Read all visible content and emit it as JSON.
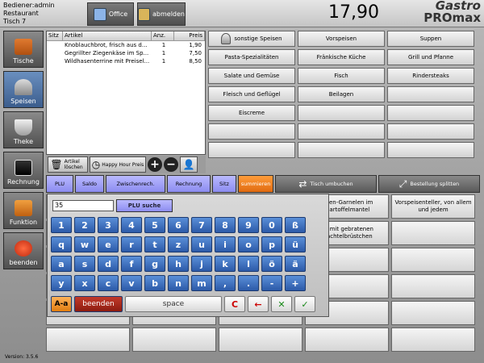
{
  "header": {
    "user_line1": "Bediener:admin",
    "user_line2": "Restaurant",
    "user_line3": "Tisch 7",
    "office_label": "Office",
    "abmelden_label": "abmelden",
    "total": "17,90",
    "logo_line1": "Gastro",
    "logo_line2": "PROmax"
  },
  "nav": [
    {
      "label": "Tische"
    },
    {
      "label": "Speisen"
    },
    {
      "label": "Theke"
    },
    {
      "label": "Rechnung"
    },
    {
      "label": "Funktion"
    },
    {
      "label": "beenden"
    }
  ],
  "version": "Version: 3.5.6",
  "order": {
    "columns": [
      "Sitz",
      "Artikel",
      "Anz.",
      "Preis"
    ],
    "rows": [
      {
        "sitz": "",
        "artikel": "Knoblauchbrot, frisch aus d...",
        "anz": "1",
        "preis": "1,90"
      },
      {
        "sitz": "",
        "artikel": "Gegrillter Ziegenkäse im Sp...",
        "anz": "1",
        "preis": "7,50"
      },
      {
        "sitz": "",
        "artikel": "Wildhasenterrine mit Preisel...",
        "anz": "1",
        "preis": "8,50"
      }
    ],
    "actions": {
      "delete_label": "Artikel löschen",
      "happy_hour_label": "Happy Hour Preis"
    }
  },
  "categories": [
    "sonstige Speisen",
    "Vorspeisen",
    "Suppen",
    "Pasta-Spezialitäten",
    "Fränkische Küche",
    "Grill und Pfanne",
    "Salate und Gemüse",
    "Fisch",
    "Rindersteaks",
    "Fleisch und Geflügel",
    "Beilagen",
    "",
    "Eiscreme",
    "",
    "",
    "",
    "",
    "",
    "",
    "",
    ""
  ],
  "function_strip": {
    "plu": "PLU",
    "saldo": "Saldo",
    "zwischenrech": "Zwischenrech.",
    "rechnung": "Rechnung",
    "sitz": "Sitz",
    "summieren": "summieren",
    "tisch_umbuchen": "Tisch umbuchen",
    "bestellung_splitten": "Bestellung splitten"
  },
  "products": [
    "",
    "",
    "",
    "...sen-Garnelen im ...artoffelmantel",
    "Vorspeisenteller, von allem und jedem",
    "",
    "",
    "",
    "...t mit gebratenen ...achtelbrüstchen",
    "",
    "",
    "",
    "",
    "",
    "",
    "",
    "",
    "",
    "",
    "",
    "",
    "",
    "",
    "",
    "",
    "",
    "",
    "",
    "",
    ""
  ],
  "keyboard": {
    "input_value": "35",
    "plu_search_label": "PLU suche",
    "row1": [
      "1",
      "2",
      "3",
      "4",
      "5",
      "6",
      "7",
      "8",
      "9",
      "0",
      "ß"
    ],
    "row2": [
      "q",
      "w",
      "e",
      "r",
      "t",
      "z",
      "u",
      "i",
      "o",
      "p",
      "ü"
    ],
    "row3": [
      "a",
      "s",
      "d",
      "f",
      "g",
      "h",
      "j",
      "k",
      "l",
      "ö",
      "ä"
    ],
    "row4": [
      "y",
      "x",
      "c",
      "v",
      "b",
      "n",
      "m",
      ",",
      ".",
      "-",
      "+"
    ],
    "shift_label": "A-a",
    "beenden_label": "beenden",
    "space_label": "space",
    "clear_label": "C",
    "check_label": "✓"
  }
}
